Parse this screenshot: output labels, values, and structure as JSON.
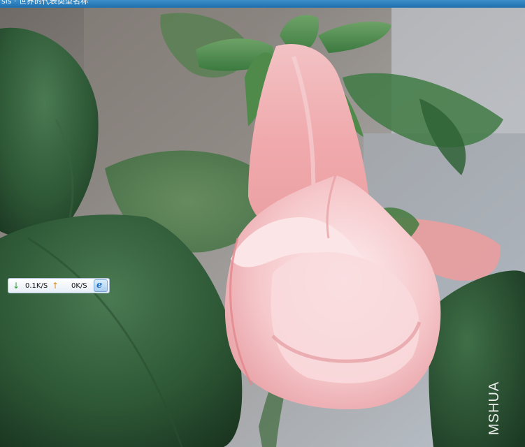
{
  "window": {
    "title": "sis · 世界的代表类型名称"
  },
  "photo": {
    "subject": "pink gloxinia-like flower bud with green leaves"
  },
  "speed_widget": {
    "download_label": "0.1K/S",
    "upload_label": "0K/S",
    "download_arrow": "↓",
    "upload_arrow": "↑",
    "ie_label": "e",
    "download_color": "#2aa12a",
    "upload_color": "#e08a10"
  },
  "watermark": {
    "text": "MSHUA"
  }
}
